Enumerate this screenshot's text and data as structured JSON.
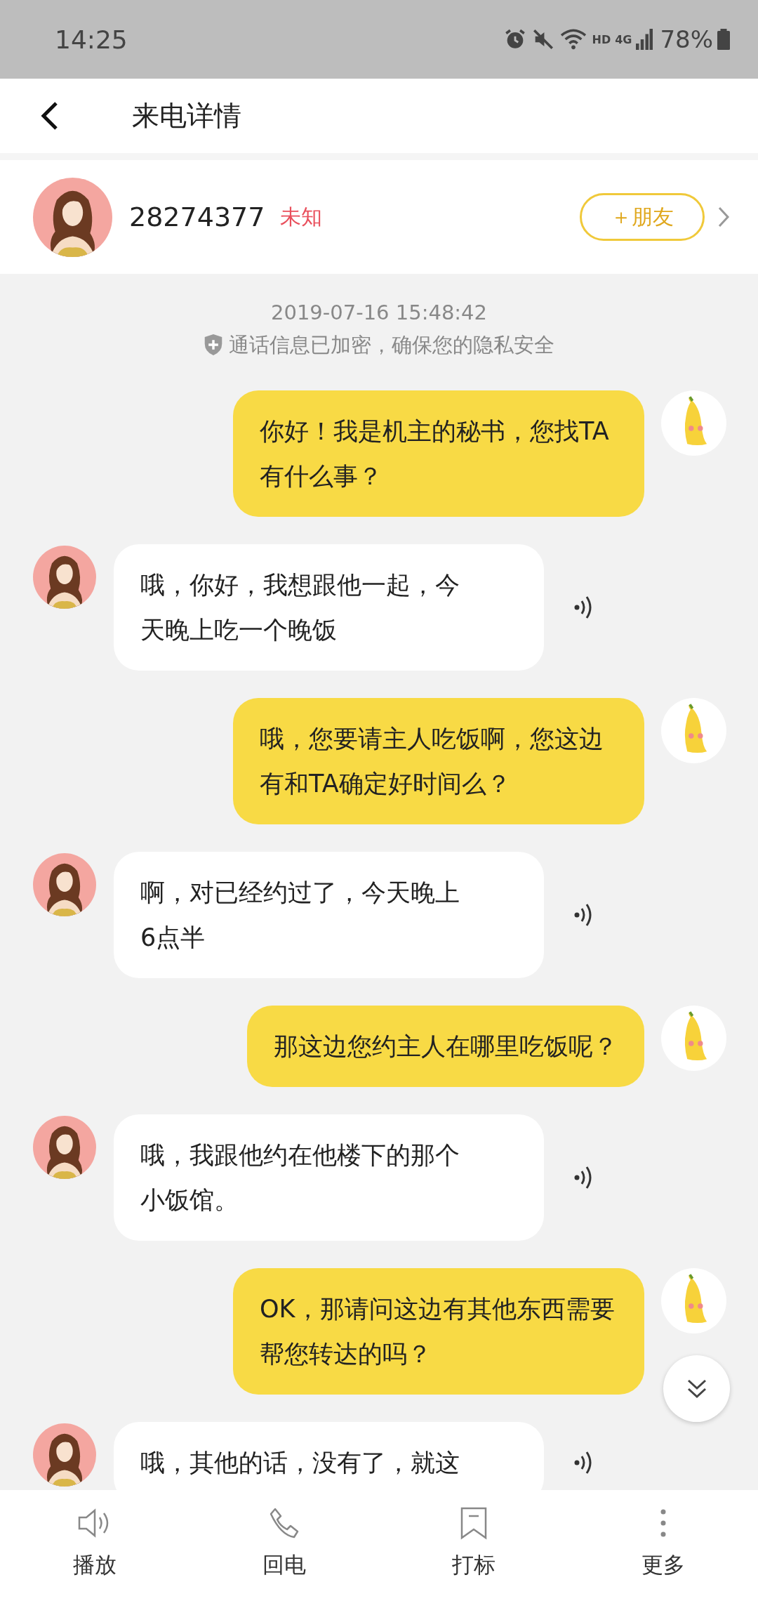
{
  "status_bar": {
    "time": "14:25",
    "network_labels": [
      "HD",
      "4G"
    ],
    "battery": "78%"
  },
  "header": {
    "title": "来电详情"
  },
  "caller": {
    "number": "28274377",
    "tag": "未知",
    "add_button": "＋朋友"
  },
  "chat": {
    "timestamp": "2019-07-16 15:48:42",
    "notice": "通话信息已加密，确保您的隐私安全",
    "messages": [
      {
        "kind": "secretary",
        "text": "你好！我是机主的秘书，您找TA有什么事？"
      },
      {
        "kind": "caller",
        "text": "哦，你好，我想跟他一起，今天晚上吃一个晚饭"
      },
      {
        "kind": "secretary",
        "text": "哦，您要请主人吃饭啊，您这边有和TA确定好时间么？"
      },
      {
        "kind": "caller",
        "text": "啊，对已经约过了，今天晚上6点半"
      },
      {
        "kind": "secretary",
        "text": "那这边您约主人在哪里吃饭呢？"
      },
      {
        "kind": "caller",
        "text": "哦，我跟他约在他楼下的那个小饭馆。"
      },
      {
        "kind": "secretary",
        "text": "OK，那请问这边有其他东西需要帮您转达的吗？"
      },
      {
        "kind": "caller",
        "text": "哦，其他的话，没有了，就这"
      }
    ]
  },
  "bottom_bar": [
    {
      "label": "播放"
    },
    {
      "label": "回电"
    },
    {
      "label": "打标"
    },
    {
      "label": "更多"
    }
  ]
}
